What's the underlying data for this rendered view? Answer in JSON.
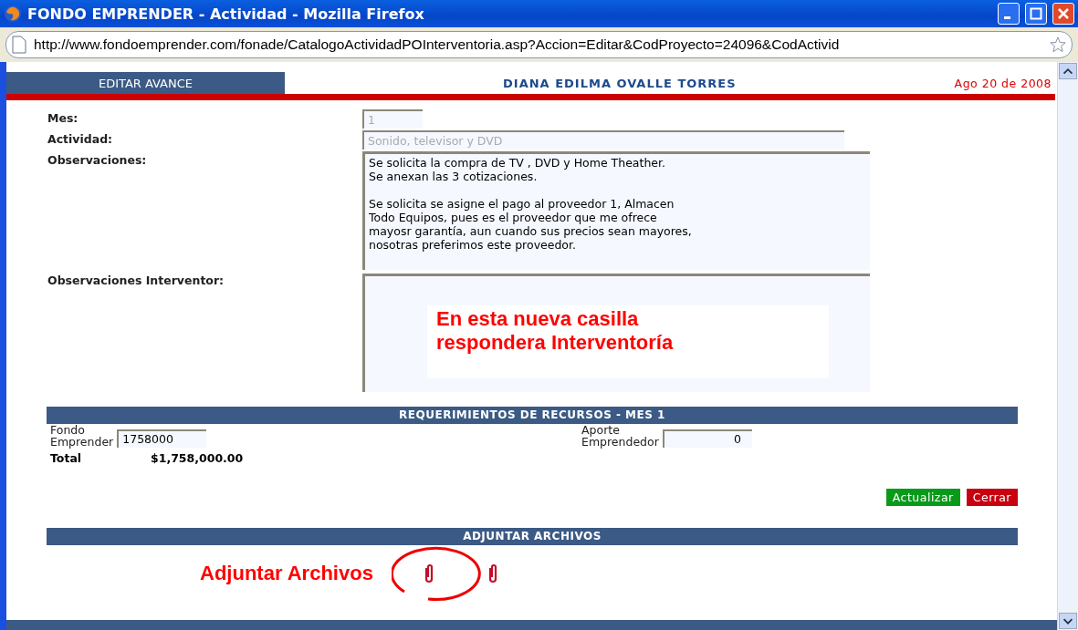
{
  "window": {
    "title": "FONDO EMPRENDER - Actividad - Mozilla Firefox"
  },
  "address_bar": {
    "url": "http://www.fondoemprender.com/fonade/CatalogoActividadPOInterventoria.asp?Accion=Editar&CodProyecto=24096&CodActivid"
  },
  "header": {
    "tab": "EDITAR AVANCE",
    "user": "DIANA EDILMA OVALLE TORRES",
    "date": "Ago 20 de 2008"
  },
  "form": [
    {
      "label": "Mes:",
      "kind": "short",
      "value": "1",
      "disabled": true
    },
    {
      "label": "Actividad:",
      "kind": "wide",
      "value": "Sonido, televisor y DVD",
      "disabled": true
    },
    {
      "label": "Observaciones:",
      "kind": "area",
      "value": "Se solicita la compra de TV , DVD y Home Theather.\nSe anexan las 3 cotizaciones.\n\nSe solicita se asigne el pago al proveedor 1, Almacen\nTodo Equipos, pues es el proveedor que me ofrece\nmayosr garantía, aun cuando sus precios sean mayores,\nnosotras preferimos este proveedor."
    },
    {
      "label": "Observaciones Interventor:",
      "kind": "area",
      "note": "En esta nueva casilla\nrespondera Interventoría"
    }
  ],
  "resources": {
    "title": "REQUERIMIENTOS DE RECURSOS - MES 1",
    "fondo_label": "Fondo\nEmprender",
    "fondo_value": "1758000",
    "aporte_label": "Aporte\nEmprendedor",
    "aporte_value": "0",
    "total_label": "Total",
    "total_value": "$1,758,000.00"
  },
  "buttons": [
    {
      "label": "Actualizar",
      "kind": "update"
    },
    {
      "label": "Cerrar",
      "kind": "close"
    }
  ],
  "attachments": {
    "title": "ADJUNTAR ARCHIVOS",
    "note": "Adjuntar Archivos"
  }
}
